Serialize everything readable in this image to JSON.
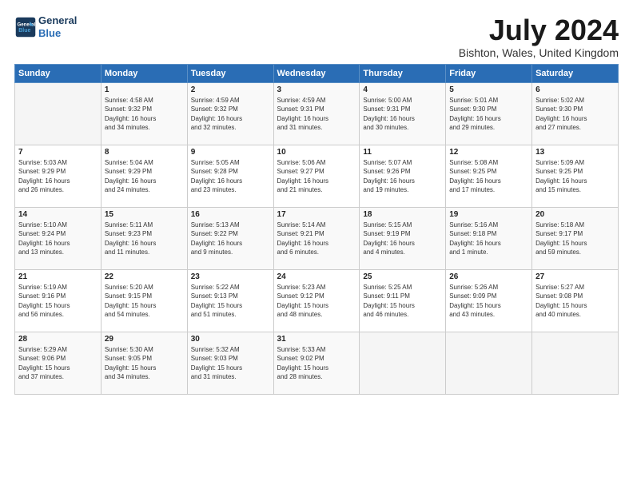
{
  "header": {
    "logo_line1": "General",
    "logo_line2": "Blue",
    "title": "July 2024",
    "location": "Bishton, Wales, United Kingdom"
  },
  "days_of_week": [
    "Sunday",
    "Monday",
    "Tuesday",
    "Wednesday",
    "Thursday",
    "Friday",
    "Saturday"
  ],
  "weeks": [
    [
      {
        "day": "",
        "info": ""
      },
      {
        "day": "1",
        "info": "Sunrise: 4:58 AM\nSunset: 9:32 PM\nDaylight: 16 hours\nand 34 minutes."
      },
      {
        "day": "2",
        "info": "Sunrise: 4:59 AM\nSunset: 9:32 PM\nDaylight: 16 hours\nand 32 minutes."
      },
      {
        "day": "3",
        "info": "Sunrise: 4:59 AM\nSunset: 9:31 PM\nDaylight: 16 hours\nand 31 minutes."
      },
      {
        "day": "4",
        "info": "Sunrise: 5:00 AM\nSunset: 9:31 PM\nDaylight: 16 hours\nand 30 minutes."
      },
      {
        "day": "5",
        "info": "Sunrise: 5:01 AM\nSunset: 9:30 PM\nDaylight: 16 hours\nand 29 minutes."
      },
      {
        "day": "6",
        "info": "Sunrise: 5:02 AM\nSunset: 9:30 PM\nDaylight: 16 hours\nand 27 minutes."
      }
    ],
    [
      {
        "day": "7",
        "info": "Sunrise: 5:03 AM\nSunset: 9:29 PM\nDaylight: 16 hours\nand 26 minutes."
      },
      {
        "day": "8",
        "info": "Sunrise: 5:04 AM\nSunset: 9:29 PM\nDaylight: 16 hours\nand 24 minutes."
      },
      {
        "day": "9",
        "info": "Sunrise: 5:05 AM\nSunset: 9:28 PM\nDaylight: 16 hours\nand 23 minutes."
      },
      {
        "day": "10",
        "info": "Sunrise: 5:06 AM\nSunset: 9:27 PM\nDaylight: 16 hours\nand 21 minutes."
      },
      {
        "day": "11",
        "info": "Sunrise: 5:07 AM\nSunset: 9:26 PM\nDaylight: 16 hours\nand 19 minutes."
      },
      {
        "day": "12",
        "info": "Sunrise: 5:08 AM\nSunset: 9:25 PM\nDaylight: 16 hours\nand 17 minutes."
      },
      {
        "day": "13",
        "info": "Sunrise: 5:09 AM\nSunset: 9:25 PM\nDaylight: 16 hours\nand 15 minutes."
      }
    ],
    [
      {
        "day": "14",
        "info": "Sunrise: 5:10 AM\nSunset: 9:24 PM\nDaylight: 16 hours\nand 13 minutes."
      },
      {
        "day": "15",
        "info": "Sunrise: 5:11 AM\nSunset: 9:23 PM\nDaylight: 16 hours\nand 11 minutes."
      },
      {
        "day": "16",
        "info": "Sunrise: 5:13 AM\nSunset: 9:22 PM\nDaylight: 16 hours\nand 9 minutes."
      },
      {
        "day": "17",
        "info": "Sunrise: 5:14 AM\nSunset: 9:21 PM\nDaylight: 16 hours\nand 6 minutes."
      },
      {
        "day": "18",
        "info": "Sunrise: 5:15 AM\nSunset: 9:19 PM\nDaylight: 16 hours\nand 4 minutes."
      },
      {
        "day": "19",
        "info": "Sunrise: 5:16 AM\nSunset: 9:18 PM\nDaylight: 16 hours\nand 1 minute."
      },
      {
        "day": "20",
        "info": "Sunrise: 5:18 AM\nSunset: 9:17 PM\nDaylight: 15 hours\nand 59 minutes."
      }
    ],
    [
      {
        "day": "21",
        "info": "Sunrise: 5:19 AM\nSunset: 9:16 PM\nDaylight: 15 hours\nand 56 minutes."
      },
      {
        "day": "22",
        "info": "Sunrise: 5:20 AM\nSunset: 9:15 PM\nDaylight: 15 hours\nand 54 minutes."
      },
      {
        "day": "23",
        "info": "Sunrise: 5:22 AM\nSunset: 9:13 PM\nDaylight: 15 hours\nand 51 minutes."
      },
      {
        "day": "24",
        "info": "Sunrise: 5:23 AM\nSunset: 9:12 PM\nDaylight: 15 hours\nand 48 minutes."
      },
      {
        "day": "25",
        "info": "Sunrise: 5:25 AM\nSunset: 9:11 PM\nDaylight: 15 hours\nand 46 minutes."
      },
      {
        "day": "26",
        "info": "Sunrise: 5:26 AM\nSunset: 9:09 PM\nDaylight: 15 hours\nand 43 minutes."
      },
      {
        "day": "27",
        "info": "Sunrise: 5:27 AM\nSunset: 9:08 PM\nDaylight: 15 hours\nand 40 minutes."
      }
    ],
    [
      {
        "day": "28",
        "info": "Sunrise: 5:29 AM\nSunset: 9:06 PM\nDaylight: 15 hours\nand 37 minutes."
      },
      {
        "day": "29",
        "info": "Sunrise: 5:30 AM\nSunset: 9:05 PM\nDaylight: 15 hours\nand 34 minutes."
      },
      {
        "day": "30",
        "info": "Sunrise: 5:32 AM\nSunset: 9:03 PM\nDaylight: 15 hours\nand 31 minutes."
      },
      {
        "day": "31",
        "info": "Sunrise: 5:33 AM\nSunset: 9:02 PM\nDaylight: 15 hours\nand 28 minutes."
      },
      {
        "day": "",
        "info": ""
      },
      {
        "day": "",
        "info": ""
      },
      {
        "day": "",
        "info": ""
      }
    ]
  ]
}
